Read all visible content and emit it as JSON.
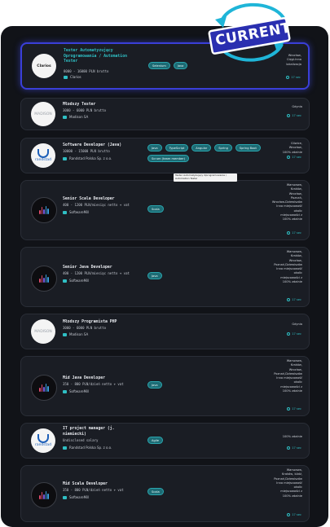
{
  "badge": {
    "label": "CURRENT"
  },
  "jobs": [
    {
      "title": "Tester Automatyzujący Oprogramowania / Automation Tester",
      "salary": "8000 - 16000 PLN brutto",
      "company": "Clarios",
      "logo_text": "Clarios",
      "tags": [
        "Selenium",
        "Java"
      ],
      "location": "Wrocław,\nCięgi-lnna\nlokalizacja",
      "time": "17 sec"
    },
    {
      "title": "Młodszy Tester",
      "salary": "3000 - 6000 PLN brutto",
      "company": "Madison SA",
      "logo_text": "MADISON",
      "tags": [],
      "location": "Gdynia",
      "time": "17 sec"
    },
    {
      "title": "Software Developer (Java)",
      "salary": "10000 - 15000 PLN brutto",
      "company": "Randstad Polska Sp. z o.o.",
      "logo_text": "randstad",
      "tags": [
        "Java",
        "TypeScript",
        "Angular",
        "Spring",
        "Spring Boot",
        "Scrum (team member)"
      ],
      "location": "Gliwice,\nWrocław,\n100% zdalnie",
      "time": "17 sec"
    },
    {
      "title": "Senior Scala Developer",
      "salary": "400 - 1200 PLN/miesiąc netto + vat",
      "company": "SoftwareMill",
      "logo_text": "softwaremill",
      "tags": [
        "Scala"
      ],
      "location": "Warszawa,\nKraków,\nWrocław,\nPoznań,\nWrocław-Dziewiszów\nInna miejscowość\nokolic\nmiejscowości z\n100% zdalnie",
      "time": "17 sec"
    },
    {
      "title": "Senior Java Developer",
      "salary": "400 - 1200 PLN/miesiąc netto + vat",
      "company": "SoftwareMill",
      "logo_text": "softwaremill",
      "tags": [
        "Java"
      ],
      "location": "Warszawa,\nKraków,\nWrocław,\nPoznań,Dziewiszów\nInna miejscowość\nokolic\nmiejscowości z\n100% zdalnie",
      "time": "17 sec"
    },
    {
      "title": "Młodszy Programista PHP",
      "salary": "3000 - 6000 PLN brutto",
      "company": "Madison SA",
      "logo_text": "MADISON",
      "tags": [],
      "location": "Gdynia",
      "time": "17 sec"
    },
    {
      "title": "Mid Java Developer",
      "salary": "350 - 800 PLN/dzień netto + vat",
      "company": "SoftwareMill",
      "logo_text": "softwaremill",
      "tags": [
        "Java"
      ],
      "location": "Warszawa,\nKraków,\nWrocław,\nPoznań,Dziewiszów\nInna miejscowość\nokolic\nmiejscowości z\n100% zdalnie",
      "time": "17 sec"
    },
    {
      "title": "IT project manager (j. niemiecki)",
      "salary": "Undisclosed salary",
      "company": "Randstad Polska Sp. z o.o.",
      "logo_text": "randstad",
      "tags": [
        "Agile"
      ],
      "location": "100% zdalnie",
      "time": "17 sec"
    },
    {
      "title": "Mid Scala Developer",
      "salary": "350 - 800 PLN/dzień netto + vat",
      "company": "SoftwareMill",
      "logo_text": "softwaremill",
      "tags": [
        "Scala"
      ],
      "location": "Warszawa,\nKraków, Łódź,\nPoznań,Dziewiszów\nInna miejscowość\nokolic\nmiejscowości z\n100% zdalnie",
      "time": "17 sec"
    }
  ],
  "tooltip": "Tester Automatyzujący Oprogramowania / Automation Tester",
  "colors": {
    "accent": "#2fbfc4",
    "badge": "#2a2fb0",
    "arrows": "#1fb5d8"
  }
}
